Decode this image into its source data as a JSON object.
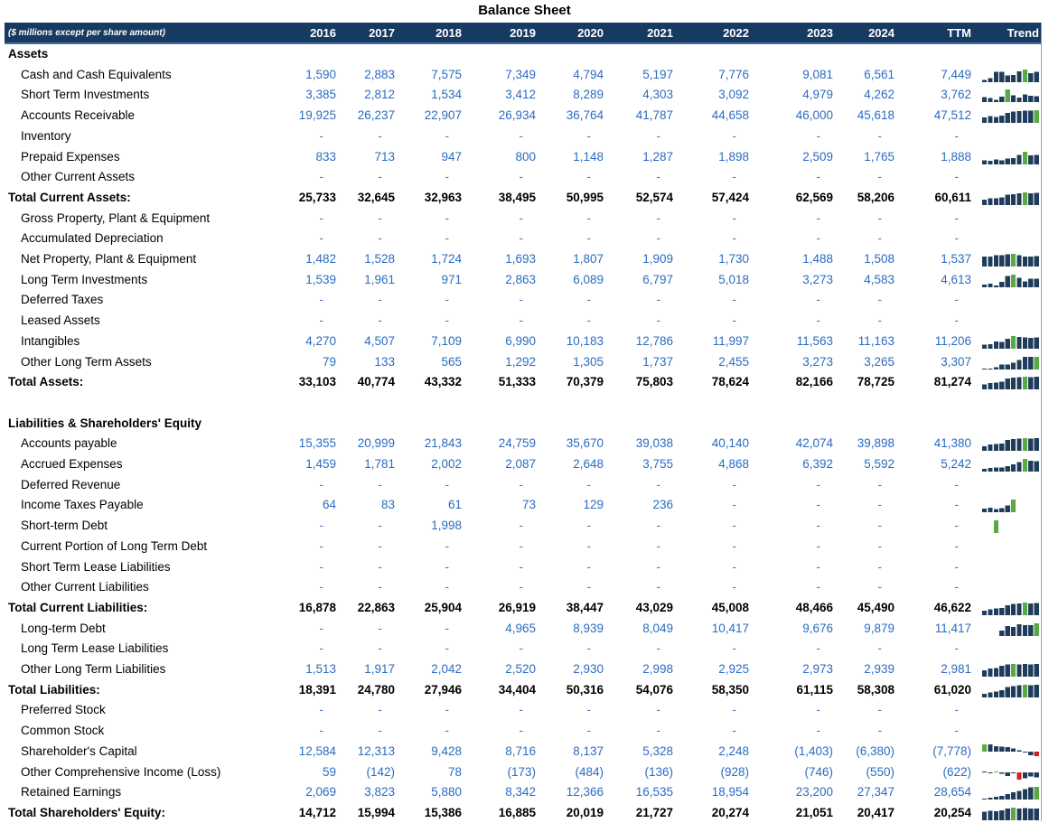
{
  "title": "Balance Sheet",
  "header": {
    "units": "($ millions except per share amount)",
    "years": [
      "2016",
      "2017",
      "2018",
      "2019",
      "2020",
      "2021",
      "2022",
      "2023",
      "2024",
      "TTM"
    ],
    "trend": "Trend"
  },
  "colors": {
    "header_bg": "#173a63",
    "value_blue": "#2a6cc2",
    "bar_dark": "#1f3d5a",
    "bar_max": "#5aaa44",
    "bar_min": "#cc2222"
  },
  "rows": [
    {
      "label": "Assets",
      "type": "section",
      "values": []
    },
    {
      "label": "Cash and Cash Equivalents",
      "type": "item",
      "values": [
        "1,590",
        "2,883",
        "7,575",
        "7,349",
        "4,794",
        "5,197",
        "7,776",
        "9,081",
        "6,561",
        "7,449"
      ]
    },
    {
      "label": "Short Term Investments",
      "type": "item",
      "values": [
        "3,385",
        "2,812",
        "1,534",
        "3,412",
        "8,289",
        "4,303",
        "3,092",
        "4,979",
        "4,262",
        "3,762"
      ]
    },
    {
      "label": "Accounts Receivable",
      "type": "item",
      "values": [
        "19,925",
        "26,237",
        "22,907",
        "26,934",
        "36,764",
        "41,787",
        "44,658",
        "46,000",
        "45,618",
        "47,512"
      ]
    },
    {
      "label": "Inventory",
      "type": "item",
      "values": [
        "-",
        "-",
        "-",
        "-",
        "-",
        "-",
        "-",
        "-",
        "-",
        "-"
      ]
    },
    {
      "label": "Prepaid Expenses",
      "type": "item",
      "values": [
        "833",
        "713",
        "947",
        "800",
        "1,148",
        "1,287",
        "1,898",
        "2,509",
        "1,765",
        "1,888"
      ]
    },
    {
      "label": "Other Current Assets",
      "type": "item",
      "values": [
        "-",
        "-",
        "-",
        "-",
        "-",
        "-",
        "-",
        "-",
        "-",
        "-"
      ]
    },
    {
      "label": "Total Current Assets:",
      "type": "total",
      "values": [
        "25,733",
        "32,645",
        "32,963",
        "38,495",
        "50,995",
        "52,574",
        "57,424",
        "62,569",
        "58,206",
        "60,611"
      ]
    },
    {
      "label": "Gross Property, Plant & Equipment",
      "type": "item",
      "values": [
        "-",
        "-",
        "-",
        "-",
        "-",
        "-",
        "-",
        "-",
        "-",
        "-"
      ]
    },
    {
      "label": "Accumulated Depreciation",
      "type": "item",
      "values": [
        "-",
        "-",
        "-",
        "-",
        "-",
        "-",
        "-",
        "-",
        "-",
        "-"
      ]
    },
    {
      "label": "Net Property, Plant & Equipment",
      "type": "item",
      "values": [
        "1,482",
        "1,528",
        "1,724",
        "1,693",
        "1,807",
        "1,909",
        "1,730",
        "1,488",
        "1,508",
        "1,537"
      ]
    },
    {
      "label": "Long Term Investments",
      "type": "item",
      "values": [
        "1,539",
        "1,961",
        "971",
        "2,863",
        "6,089",
        "6,797",
        "5,018",
        "3,273",
        "4,583",
        "4,613"
      ]
    },
    {
      "label": "Deferred Taxes",
      "type": "item",
      "values": [
        "-",
        "-",
        "-",
        "-",
        "-",
        "-",
        "-",
        "-",
        "-",
        "-"
      ]
    },
    {
      "label": "Leased Assets",
      "type": "item",
      "values": [
        "-",
        "-",
        "-",
        "-",
        "-",
        "-",
        "-",
        "-",
        "-",
        "-"
      ]
    },
    {
      "label": "Intangibles",
      "type": "item",
      "values": [
        "4,270",
        "4,507",
        "7,109",
        "6,990",
        "10,183",
        "12,786",
        "11,997",
        "11,563",
        "11,163",
        "11,206"
      ]
    },
    {
      "label": "Other Long Term Assets",
      "type": "item",
      "values": [
        "79",
        "133",
        "565",
        "1,292",
        "1,305",
        "1,737",
        "2,455",
        "3,273",
        "3,265",
        "3,307"
      ]
    },
    {
      "label": "Total Assets:",
      "type": "total",
      "values": [
        "33,103",
        "40,774",
        "43,332",
        "51,333",
        "70,379",
        "75,803",
        "78,624",
        "82,166",
        "78,725",
        "81,274"
      ]
    },
    {
      "label": "",
      "type": "blank",
      "values": []
    },
    {
      "label": "Liabilities & Shareholders' Equity",
      "type": "section",
      "values": []
    },
    {
      "label": "Accounts payable",
      "type": "item",
      "values": [
        "15,355",
        "20,999",
        "21,843",
        "24,759",
        "35,670",
        "39,038",
        "40,140",
        "42,074",
        "39,898",
        "41,380"
      ]
    },
    {
      "label": "Accrued Expenses",
      "type": "item",
      "values": [
        "1,459",
        "1,781",
        "2,002",
        "2,087",
        "2,648",
        "3,755",
        "4,868",
        "6,392",
        "5,592",
        "5,242"
      ]
    },
    {
      "label": "Deferred Revenue",
      "type": "item",
      "values": [
        "-",
        "-",
        "-",
        "-",
        "-",
        "-",
        "-",
        "-",
        "-",
        "-"
      ]
    },
    {
      "label": "Income Taxes Payable",
      "type": "item",
      "values": [
        "64",
        "83",
        "61",
        "73",
        "129",
        "236",
        "-",
        "-",
        "-",
        "-"
      ]
    },
    {
      "label": "Short-term Debt",
      "type": "item",
      "values": [
        "-",
        "-",
        "1,998",
        "-",
        "-",
        "-",
        "-",
        "-",
        "-",
        "-"
      ]
    },
    {
      "label": "Current Portion of Long Term Debt",
      "type": "item",
      "values": [
        "-",
        "-",
        "-",
        "-",
        "-",
        "-",
        "-",
        "-",
        "-",
        "-"
      ]
    },
    {
      "label": "Short Term Lease Liabilities",
      "type": "item",
      "values": [
        "-",
        "-",
        "-",
        "-",
        "-",
        "-",
        "-",
        "-",
        "-",
        "-"
      ]
    },
    {
      "label": "Other Current Liabilities",
      "type": "item",
      "values": [
        "-",
        "-",
        "-",
        "-",
        "-",
        "-",
        "-",
        "-",
        "-",
        "-"
      ]
    },
    {
      "label": "Total Current Liabilities:",
      "type": "total",
      "values": [
        "16,878",
        "22,863",
        "25,904",
        "26,919",
        "38,447",
        "43,029",
        "45,008",
        "48,466",
        "45,490",
        "46,622"
      ]
    },
    {
      "label": "Long-term Debt",
      "type": "item",
      "values": [
        "-",
        "-",
        "-",
        "4,965",
        "8,939",
        "8,049",
        "10,417",
        "9,676",
        "9,879",
        "11,417"
      ]
    },
    {
      "label": "Long Term Lease Liabilities",
      "type": "item",
      "values": [
        "-",
        "-",
        "-",
        "-",
        "-",
        "-",
        "-",
        "-",
        "-",
        "-"
      ]
    },
    {
      "label": "Other Long Term Liabilities",
      "type": "item",
      "values": [
        "1,513",
        "1,917",
        "2,042",
        "2,520",
        "2,930",
        "2,998",
        "2,925",
        "2,973",
        "2,939",
        "2,981"
      ]
    },
    {
      "label": "Total Liabilities:",
      "type": "total",
      "values": [
        "18,391",
        "24,780",
        "27,946",
        "34,404",
        "50,316",
        "54,076",
        "58,350",
        "61,115",
        "58,308",
        "61,020"
      ]
    },
    {
      "label": "Preferred Stock",
      "type": "item",
      "values": [
        "-",
        "-",
        "-",
        "-",
        "-",
        "-",
        "-",
        "-",
        "-",
        "-"
      ]
    },
    {
      "label": "Common Stock",
      "type": "item",
      "values": [
        "-",
        "-",
        "-",
        "-",
        "-",
        "-",
        "-",
        "-",
        "-",
        "-"
      ]
    },
    {
      "label": "Shareholder's Capital",
      "type": "item",
      "values": [
        "12,584",
        "12,313",
        "9,428",
        "8,716",
        "8,137",
        "5,328",
        "2,248",
        "(1,403)",
        "(6,380)",
        "(7,778)"
      ]
    },
    {
      "label": "Other Comprehensive Income (Loss)",
      "type": "item",
      "values": [
        "59",
        "(142)",
        "78",
        "(173)",
        "(484)",
        "(136)",
        "(928)",
        "(746)",
        "(550)",
        "(622)"
      ]
    },
    {
      "label": "Retained Earnings",
      "type": "item",
      "values": [
        "2,069",
        "3,823",
        "5,880",
        "8,342",
        "12,366",
        "16,535",
        "18,954",
        "23,200",
        "27,347",
        "28,654"
      ]
    },
    {
      "label": "Total Shareholders' Equity:",
      "type": "total",
      "values": [
        "14,712",
        "15,994",
        "15,386",
        "16,885",
        "20,019",
        "21,727",
        "20,274",
        "21,051",
        "20,417",
        "20,254"
      ]
    }
  ]
}
